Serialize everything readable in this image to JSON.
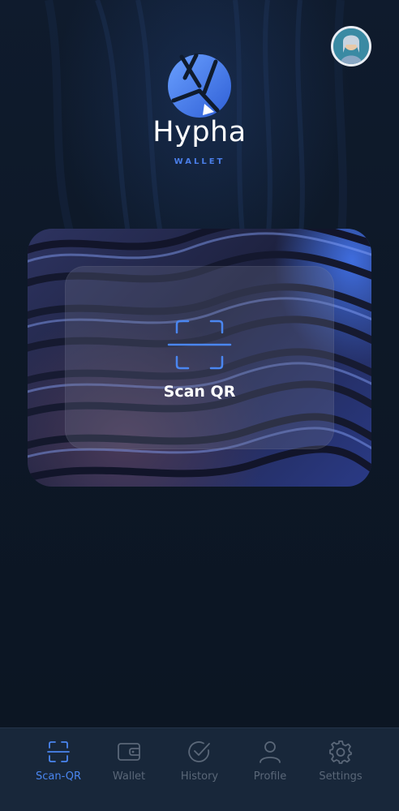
{
  "brand": {
    "name": "Hypha",
    "subtitle": "WALLET",
    "logo_icon": "hypha-logo-icon",
    "accent_color": "#4a7ee8"
  },
  "header": {
    "avatar_icon": "user-avatar"
  },
  "scan_card": {
    "label": "Scan QR",
    "icon": "scan-qr-icon"
  },
  "nav": {
    "active_index": 0,
    "active_color": "#4a86f0",
    "inactive_color": "#5a6778",
    "items": [
      {
        "label": "Scan-QR",
        "icon": "scan-qr-icon"
      },
      {
        "label": "Wallet",
        "icon": "wallet-icon"
      },
      {
        "label": "History",
        "icon": "history-check-icon"
      },
      {
        "label": "Profile",
        "icon": "profile-icon"
      },
      {
        "label": "Settings",
        "icon": "settings-gear-icon"
      }
    ]
  }
}
